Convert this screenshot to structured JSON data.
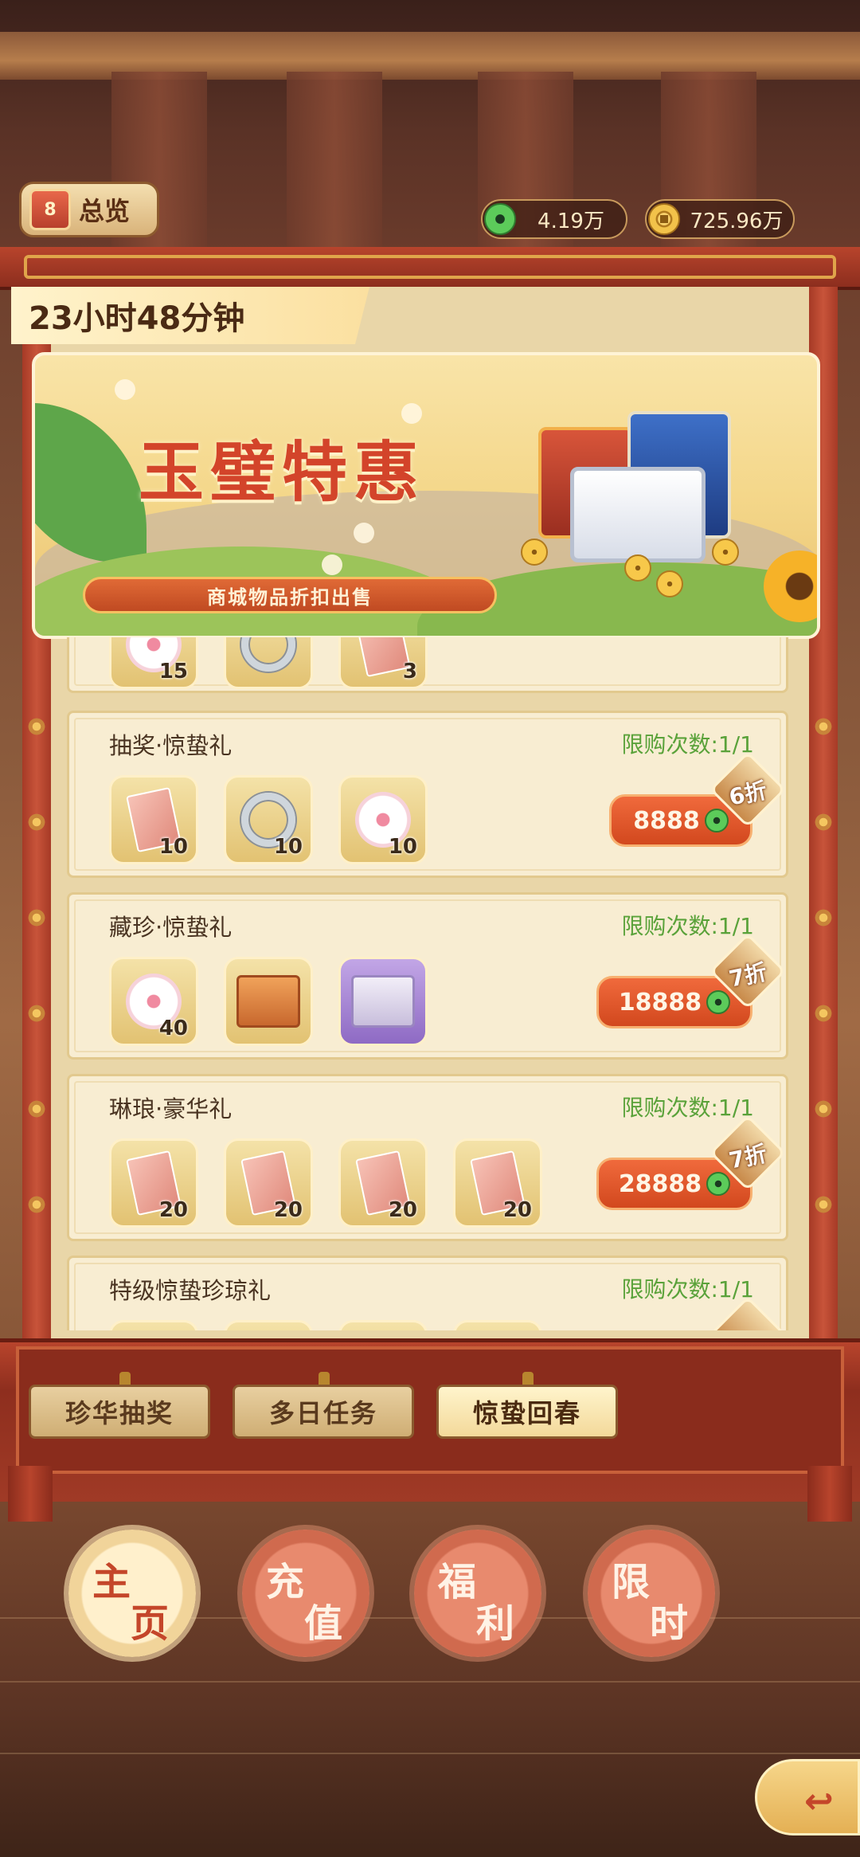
{
  "header": {
    "overview_label": "总览",
    "overview_icon_text": "8",
    "currency_jade": "4.19万",
    "currency_gold": "725.96万"
  },
  "timer": "23小时48分钟",
  "banner": {
    "title": "玉璧特惠",
    "subtitle": "商城物品折扣出售"
  },
  "partial_card": {
    "counts": [
      "15",
      "",
      "3"
    ]
  },
  "packs": [
    {
      "title": "抽奖·惊蛰礼",
      "limit": "限购次数:1/1",
      "price": "8888",
      "discount": "6折",
      "items": [
        {
          "icon": "envelope-icon",
          "count": "10"
        },
        {
          "icon": "ring-icon",
          "count": "10"
        },
        {
          "icon": "flower-icon",
          "count": "10"
        }
      ]
    },
    {
      "title": "藏珍·惊蛰礼",
      "limit": "限购次数:1/1",
      "price": "18888",
      "discount": "7折",
      "items": [
        {
          "icon": "flower-icon",
          "count": "40"
        },
        {
          "icon": "orange-chest-icon",
          "count": ""
        },
        {
          "icon": "purple-chest-icon",
          "count": ""
        }
      ]
    },
    {
      "title": "琳琅·豪华礼",
      "limit": "限购次数:1/1",
      "price": "28888",
      "discount": "7折",
      "items": [
        {
          "icon": "envelope-icon",
          "count": "20"
        },
        {
          "icon": "envelope-icon",
          "count": "20"
        },
        {
          "icon": "envelope-icon",
          "count": "20"
        },
        {
          "icon": "envelope-icon",
          "count": "20"
        }
      ]
    },
    {
      "title": "特级惊蛰珍琼礼",
      "limit": "限购次数:1/1",
      "price": "",
      "discount": "",
      "items": []
    }
  ],
  "subtabs": [
    {
      "label": "珍华抽奖",
      "active": false
    },
    {
      "label": "多日任务",
      "active": false
    },
    {
      "label": "惊蛰回春",
      "active": true
    }
  ],
  "nav": [
    {
      "c1": "主",
      "c2": "页",
      "active": true
    },
    {
      "c1": "充",
      "c2": "值",
      "active": false
    },
    {
      "c1": "福",
      "c2": "利",
      "active": false
    },
    {
      "c1": "限",
      "c2": "时",
      "active": false
    }
  ],
  "colors": {
    "accent_red": "#d3442a",
    "limit_green": "#5aa23a",
    "price_orange": "#d2481e"
  }
}
